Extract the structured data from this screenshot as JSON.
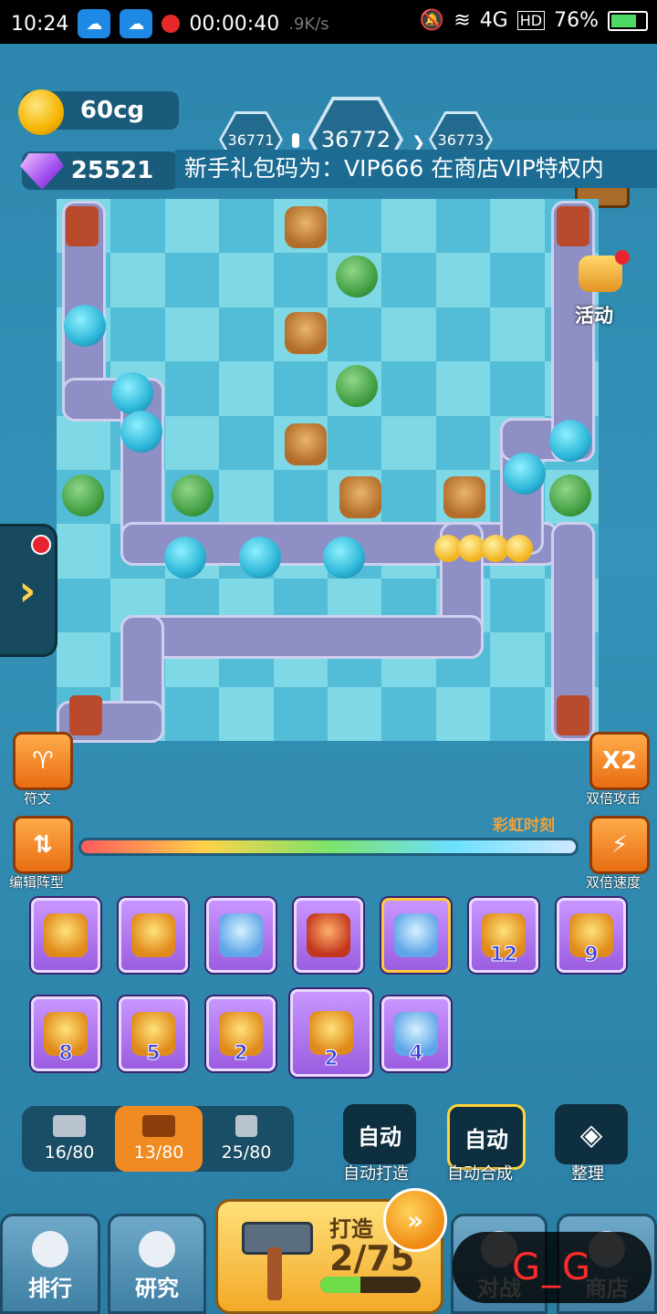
{
  "status_bar": {
    "time": "10:24",
    "record_timer": "00:00:40",
    "net_speed": ".9K/s",
    "network": "4G",
    "hd": "HD",
    "battery": "76%"
  },
  "resources": {
    "gold": "60cg",
    "gems": "25521"
  },
  "levels": {
    "previous": "36771",
    "current": "36772",
    "next": "36773"
  },
  "ticker": "新手礼包码为：VIP666 在商店VIP特权内",
  "activity_label": "活动",
  "buttons": {
    "rune": "符文",
    "edit_formation": "编辑阵型",
    "double_attack": "双倍攻击",
    "double_attack_badge": "X2",
    "double_speed": "双倍速度",
    "rainbow_time": "彩虹时刻"
  },
  "cards_row1": [
    {
      "art": "gold-wings-tower",
      "level": ""
    },
    {
      "art": "gold-wings-tower",
      "level": ""
    },
    {
      "art": "silver-ship-tower",
      "level": ""
    },
    {
      "art": "red-dragon-tower",
      "level": ""
    },
    {
      "art": "crystal-tower",
      "level": ""
    },
    {
      "art": "golden-cannon",
      "level": "12"
    },
    {
      "art": "golden-bell",
      "level": "9"
    }
  ],
  "cards_row2": [
    {
      "art": "bell-tower",
      "level": "8"
    },
    {
      "art": "lightning-jar",
      "level": "5"
    },
    {
      "art": "lightning-jar",
      "level": "2"
    },
    {
      "art": "lightning-jar",
      "level": "2"
    },
    {
      "art": "blue-orb-tower",
      "level": "4"
    }
  ],
  "materials": [
    {
      "icon": "cannon-icon",
      "value": "16/80"
    },
    {
      "icon": "scroll-icon",
      "value": "13/80"
    },
    {
      "icon": "tower-icon",
      "value": "25/80"
    }
  ],
  "auto": {
    "forge_btn": "自动",
    "forge_caption": "自动打造",
    "merge_btn": "自动",
    "merge_caption": "自动合成",
    "sort_caption": "整理"
  },
  "nav": {
    "rank": "排行",
    "research": "研究",
    "forge_label": "打造",
    "forge_count": "2/75",
    "forge_progress": 0.4,
    "battle": "对战",
    "shop": "商店"
  },
  "watermark": "G_G",
  "colors": {
    "background": "#2f8fb6",
    "accent_orange": "#f08a22",
    "card_purple": "#b47af0"
  }
}
